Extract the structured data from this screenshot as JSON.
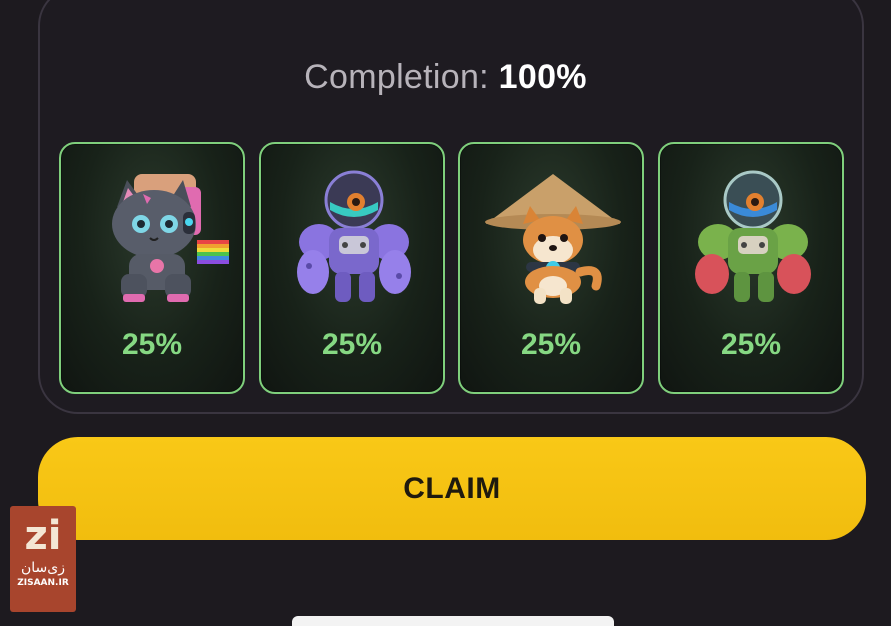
{
  "completion": {
    "label": "Completion:",
    "value": "100%"
  },
  "cards": [
    {
      "name": "Cyber Cat",
      "icon": "cyber-cat-image",
      "percent": "25%"
    },
    {
      "name": "Purple Robot",
      "icon": "purple-robot-image",
      "percent": "25%"
    },
    {
      "name": "Shiba Dog",
      "icon": "shiba-dog-image",
      "percent": "25%"
    },
    {
      "name": "Green Robot",
      "icon": "green-robot-image",
      "percent": "25%"
    }
  ],
  "claim_button": {
    "label": "CLAIM"
  },
  "watermark": {
    "logo": "zi",
    "fa": "زی‌سان",
    "en": "ZISAAN.IR"
  },
  "colors": {
    "accent_yellow": "#f9c817",
    "card_border": "#7fcf7c",
    "percent_green": "#86d883",
    "background": "#1d1a1f"
  }
}
